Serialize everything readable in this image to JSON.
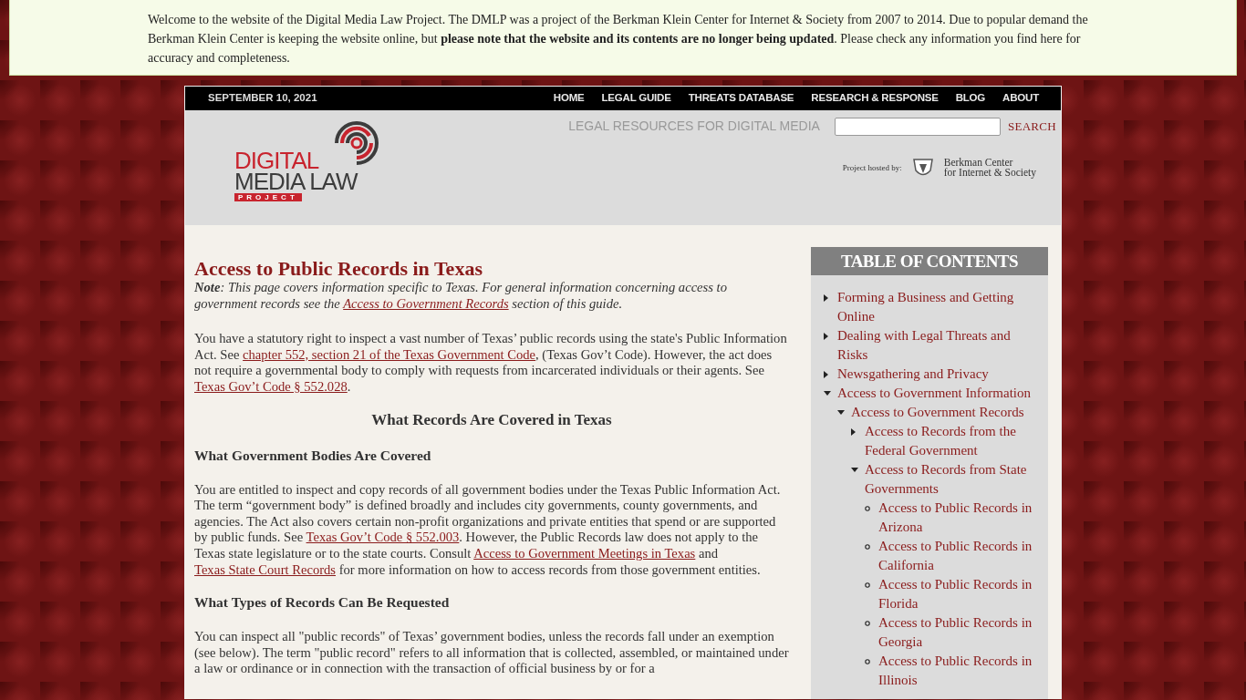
{
  "notice": {
    "text": "Welcome to the website of the Digital Media Law Project. The DMLP was a project of the Berkman Klein Center for Internet & Society from 2007 to 2014. Due to popular demand the Berkman Klein Center is keeping the website online, but **please note that the website and its contents are no longer being updated**. Please check any information you find here for accuracy and completeness."
  },
  "topbar": {
    "date": "SEPTEMBER 10, 2021",
    "nav": [
      "HOME",
      "LEGAL GUIDE",
      "THREATS DATABASE",
      "RESEARCH & RESPONSE",
      "BLOG",
      "ABOUT"
    ]
  },
  "header": {
    "logo": {
      "line_1": "DIGITAL",
      "line_2": "MEDIA LAW",
      "line_3": "PROJECT"
    },
    "tagline": "LEGAL RESOURCES FOR DIGITAL MEDIA",
    "search_button": "SEARCH",
    "hosted_by": "Project hosted by:",
    "host_lines": [
      "Berkman Center",
      "for Internet & Society"
    ]
  },
  "article": {
    "title": "Access to Public Records in Texas",
    "blocks": [
      {
        "kind": "note",
        "segments": [
          {
            "text": "**Note**: This page covers information specific to Texas. For general information concerning access to government records see the "
          },
          {
            "link": "Access to Government Records"
          },
          {
            "text": " section of this guide."
          }
        ]
      },
      {
        "kind": "para",
        "segments": [
          {
            "text": "You have a statutory right to inspect a vast number of Texas’ public records using the state's Public Information Act. See "
          },
          {
            "link": "chapter 552, section 21 of the Texas Government Code"
          },
          {
            "text": ", (Texas Gov’t Code). However, the act does not require a governmental body to comply with requests from incarcerated individuals or their agents. See "
          },
          {
            "link": "Texas Gov’t Code § 552.028"
          },
          {
            "text": "."
          }
        ]
      },
      {
        "kind": "section_heading",
        "segments": [
          {
            "text": "What Records Are Covered in Texas"
          }
        ]
      },
      {
        "kind": "subheading",
        "segments": [
          {
            "text": "What Government Bodies Are Covered"
          }
        ]
      },
      {
        "kind": "para",
        "segments": [
          {
            "text": "You are entitled to inspect and copy records of all government bodies under the Texas Public Information Act. The term “government body” is defined broadly and includes city governments, county governments, and agencies. The Act also covers certain non-profit organizations and private entities that spend or are supported by public funds. See "
          },
          {
            "link": "Texas Gov’t Code § 552.003"
          },
          {
            "text": ". However, the Public Records law does not apply to the Texas state legislature or to the state courts. Consult "
          },
          {
            "link": "Access to Government Meetings in Texas"
          },
          {
            "text": " and "
          },
          {
            "link": "Texas State Court Records"
          },
          {
            "text": " for more information on how to access records from those government entities."
          }
        ]
      },
      {
        "kind": "subheading",
        "segments": [
          {
            "text": "What Types of Records Can Be Requested"
          }
        ]
      },
      {
        "kind": "para",
        "segments": [
          {
            "text": "You can inspect all \"public records\" of Texas’ government bodies, unless the records fall under an exemption (see below). The term \"public record\" refers to all information that is collected, assembled, or maintained under a law or ordinance or in connection with the transaction of official business by or for a"
          }
        ]
      }
    ]
  },
  "toc": {
    "title": "TABLE OF CONTENTS",
    "items": [
      {
        "label": "Forming a Business and Getting Online",
        "kind": "branch",
        "expanded": false
      },
      {
        "label": "Dealing with Legal Threats and Risks",
        "kind": "branch",
        "expanded": false
      },
      {
        "label": "Newsgathering and Privacy",
        "kind": "branch",
        "expanded": false
      },
      {
        "label": "Access to Government Information",
        "kind": "branch",
        "expanded": true,
        "children": [
          {
            "label": "Access to Government Records",
            "kind": "branch",
            "expanded": true,
            "children": [
              {
                "label": "Access to Records from the Federal Government",
                "kind": "branch",
                "expanded": false
              },
              {
                "label": "Access to Records from State Governments",
                "kind": "branch",
                "expanded": true,
                "children": [
                  {
                    "label": "Access to Public Records in Arizona",
                    "kind": "leaf"
                  },
                  {
                    "label": "Access to Public Records in California",
                    "kind": "leaf"
                  },
                  {
                    "label": "Access to Public Records in Florida",
                    "kind": "leaf"
                  },
                  {
                    "label": "Access to Public Records in Georgia",
                    "kind": "leaf"
                  },
                  {
                    "label": "Access to Public Records in Illinois",
                    "kind": "leaf"
                  }
                ]
              }
            ]
          }
        ]
      }
    ]
  }
}
